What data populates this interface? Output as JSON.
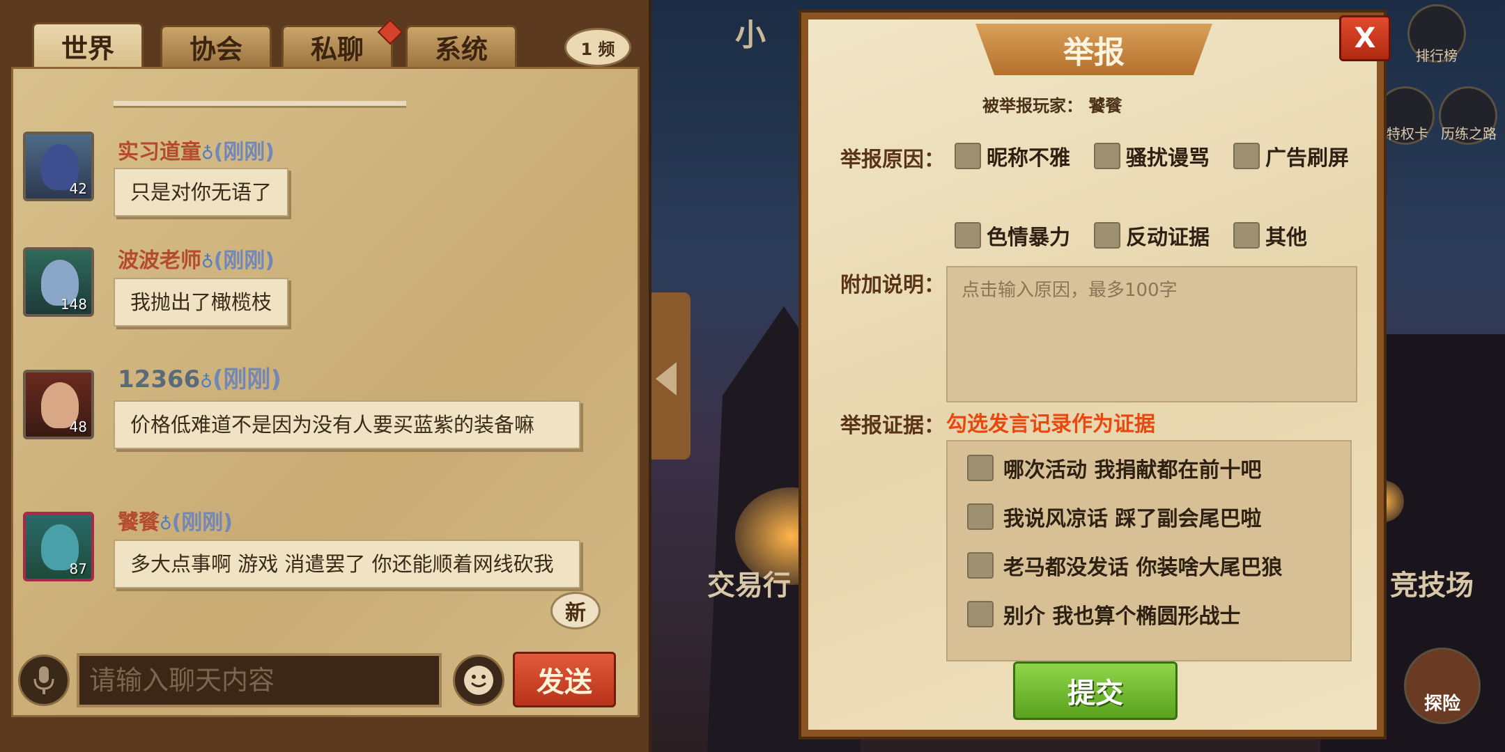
{
  "chat": {
    "tabs": [
      {
        "label": "世界"
      },
      {
        "label": "协会"
      },
      {
        "label": "私聊"
      },
      {
        "label": "系统"
      }
    ],
    "channel_label": "1 频",
    "messages": [
      {
        "name": "实习道童",
        "time": "(刚刚)",
        "level": "42",
        "text": "只是对你无语了"
      },
      {
        "name": "波波老师",
        "time": "(刚刚)",
        "level": "148",
        "text": "我抛出了橄榄枝"
      },
      {
        "name": "12366",
        "time": "(刚刚)",
        "level": "48",
        "text": "价格低难道不是因为没有人要买蓝紫的装备嘛"
      },
      {
        "name": "饕餮",
        "time": "(刚刚)",
        "level": "87",
        "text": "多大点事啊 游戏 消遣罢了 你还能顺着网线砍我"
      }
    ],
    "new_badge": "新",
    "input_placeholder": "请输入聊天内容",
    "send_label": "发送"
  },
  "scene": {
    "town_title": "小 镇",
    "label_left": "交易行",
    "label_right": "竞技场",
    "icons": [
      {
        "label": "排行榜"
      },
      {
        "label": "特权卡"
      },
      {
        "label": "历练之路"
      },
      {
        "label": "探险"
      }
    ]
  },
  "report": {
    "title": "举报",
    "close_label": "X",
    "reported_player": "被举报玩家： 饕餮",
    "reason_label": "举报原因：",
    "reasons": [
      "昵称不雅",
      "骚扰谩骂",
      "广告刷屏",
      "色情暴力",
      "反动证据",
      "其他"
    ],
    "note_label": "附加说明：",
    "note_placeholder": "点击输入原因，最多100字",
    "evidence_label": "举报证据：",
    "evidence_hint": "勾选发言记录作为证据",
    "evidence": [
      "哪次活动  我捐献都在前十吧",
      "我说风凉话  踩了副会尾巴啦",
      "老马都没发话  你装啥大尾巴狼",
      "别介  我也算个椭圆形战士"
    ],
    "submit_label": "提交"
  }
}
